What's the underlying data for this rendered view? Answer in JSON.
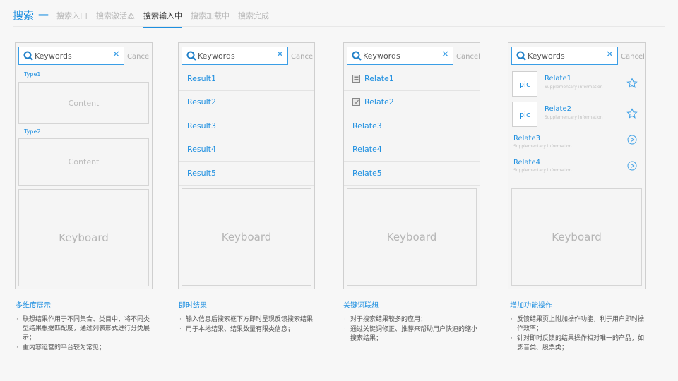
{
  "header": {
    "brand": "搜索",
    "dash": "—",
    "tabs": [
      {
        "label": "搜索入口",
        "active": false
      },
      {
        "label": "搜索激活态",
        "active": false
      },
      {
        "label": "搜索输入中",
        "active": true
      },
      {
        "label": "搜索加载中",
        "active": false
      },
      {
        "label": "搜索完成",
        "active": false
      }
    ]
  },
  "search": {
    "placeholder": "Keywords",
    "clear": "✕",
    "cancel": "Cancel"
  },
  "panel1": {
    "type1": "Type1",
    "type2": "Type2",
    "content1": "Content",
    "content2": "Content",
    "keyboard": "Keyboard"
  },
  "panel2": {
    "results": [
      "Result1",
      "Result2",
      "Result3",
      "Result4",
      "Result5"
    ],
    "keyboard": "Keyboard"
  },
  "panel3": {
    "relates": [
      "Relate1",
      "Relate2",
      "Relate3",
      "Relate4",
      "Relate5"
    ],
    "keyboard": "Keyboard"
  },
  "panel4": {
    "items": [
      {
        "pic": "pic",
        "title": "Relate1",
        "sub": "Supplementary information",
        "icon": "star-icon"
      },
      {
        "pic": "pic",
        "title": "Relate2",
        "sub": "Supplementary information",
        "icon": "star-icon"
      },
      {
        "title": "Relate3",
        "sub": "Supplementary information",
        "icon": "play-icon"
      },
      {
        "title": "Relate4",
        "sub": "Supplementary information",
        "icon": "play-icon"
      }
    ],
    "keyboard": "Keyboard"
  },
  "descriptions": [
    {
      "title": "多维度展示",
      "items": [
        "联想结果作用于不同集合、类目中，将不同类型结果根据匹配度，通过列表形式进行分类展示；",
        "重内容运营的平台较为常见；"
      ]
    },
    {
      "title": "即时结果",
      "items": [
        "输入信息后搜索框下方即时呈现反馈搜索结果",
        "用于本地结果、结果数量有限类信息；"
      ]
    },
    {
      "title": "关键词联想",
      "items": [
        "对于搜索结果较多的应用；",
        "通过关键词修正、推荐来帮助用户快速的缩小搜索结果；"
      ]
    },
    {
      "title": "增加功能操作",
      "items": [
        "反馈结果页上附加操作功能，利于用户即时操作效率；",
        "针对即时反馈的结果操作相对唯一的产品，如影音类、股票类；"
      ]
    }
  ],
  "colors": {
    "accent": "#1e8fe0",
    "border": "#cfcfcf",
    "muted": "#b5b5b5"
  }
}
